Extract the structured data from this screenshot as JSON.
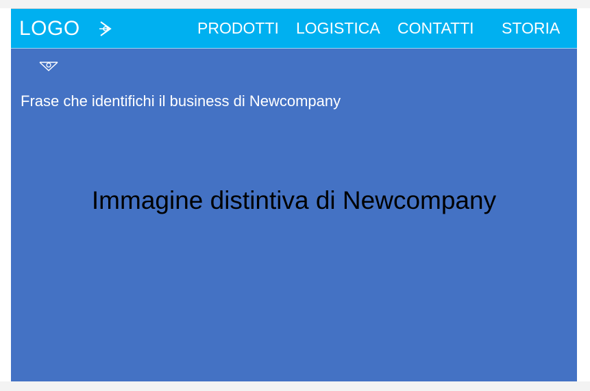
{
  "header": {
    "logo": "LOGO",
    "nav_items": [
      {
        "label": "PRODOTTI"
      },
      {
        "label": "LOGISTICA"
      },
      {
        "label": "CONTATTI"
      },
      {
        "label": "STORIA"
      }
    ]
  },
  "main": {
    "tagline": "Frase che identifichi il business di Newcompany",
    "hero_text": "Immagine distintiva di Newcompany"
  },
  "icons": {
    "nav_arrow": "arrow-right-icon",
    "dropdown": "chevron-down-icon"
  },
  "colors": {
    "header_bg": "#00b0f0",
    "body_bg": "#4472c4",
    "text_light": "#ffffff",
    "text_dark": "#000000"
  }
}
